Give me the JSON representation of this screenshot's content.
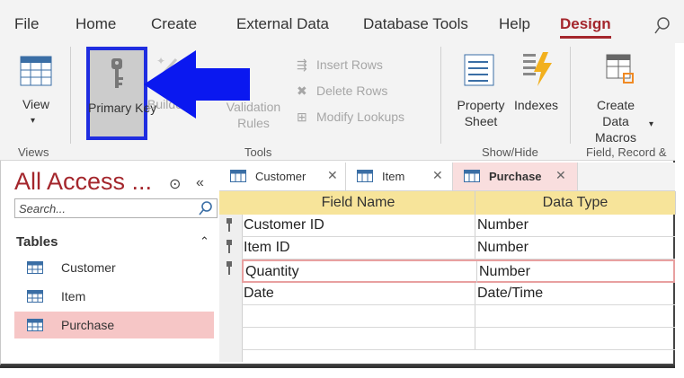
{
  "ribbon_tabs": [
    "File",
    "Home",
    "Create",
    "External Data",
    "Database Tools",
    "Help",
    "Design"
  ],
  "active_tab": "Design",
  "ribbon": {
    "view_label": "View",
    "primary_key_label": "Primary Key",
    "builder_label": "Builder",
    "validation_label": "Validation Rules",
    "insert_rows": "Insert Rows",
    "delete_rows": "Delete Rows",
    "modify_lookups": "Modify Lookups",
    "property_sheet": "Property Sheet",
    "indexes": "Indexes",
    "create_data_macros": "Create Data Macros",
    "groups": {
      "views": "Views",
      "tools": "Tools",
      "show_hide": "Show/Hide",
      "field_record": "Field, Record &"
    }
  },
  "nav": {
    "title": "All Access ...",
    "search_placeholder": "Search...",
    "section": "Tables",
    "items": [
      "Customer",
      "Item",
      "Purchase"
    ],
    "selected": "Purchase"
  },
  "doc_tabs": [
    "Customer",
    "Item",
    "Purchase"
  ],
  "active_doc_tab": "Purchase",
  "grid": {
    "headers": [
      "Field Name",
      "Data Type"
    ],
    "rows": [
      {
        "field": "Customer ID",
        "type": "Number",
        "key": true
      },
      {
        "field": "Item ID",
        "type": "Number",
        "key": true
      },
      {
        "field": "Quantity",
        "type": "Number",
        "key": true
      },
      {
        "field": "Date",
        "type": "Date/Time",
        "key": false
      }
    ]
  },
  "colors": {
    "accent": "#a4262c",
    "highlight_box": "#1f2de0",
    "arrow": "#0a18f0",
    "header_bg": "#f7e49a",
    "selected_nav": "#f6c6c6"
  }
}
